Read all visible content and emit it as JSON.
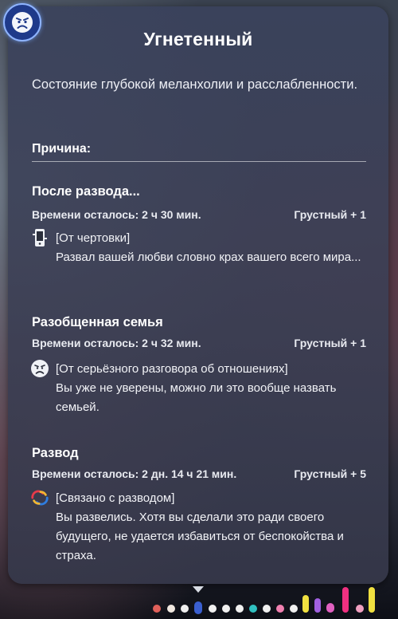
{
  "tooltip": {
    "title": "Угнетенный",
    "description": "Состояние глубокой меланхолии и расслабленности.",
    "reason_label": "Причина:",
    "mood_icon": "sad-face-icon"
  },
  "modifiers": [
    {
      "name": "После развода...",
      "time_left": "Времени осталось: 2 ч 30 мин.",
      "effect": "Грустный + 1",
      "source": "[От чертовки]",
      "text": "Развал вашей любви словно крах вашего всего мира...",
      "icon": "phone-icon"
    },
    {
      "name": "Разобщенная семья",
      "time_left": "Времени осталось: 2 ч 32 мин.",
      "effect": "Грустный + 1",
      "source": "[От серьёзного разговора об отношениях]",
      "text": "Вы уже не уверены, можно ли это вообще назвать семьей.",
      "icon": "sad-face-icon"
    },
    {
      "name": "Развод",
      "time_left": "Времени осталось: 2 дн. 14 ч 21 мин.",
      "effect": "Грустный + 5",
      "source": "[Связано с разводом]",
      "text": "Вы развелись. Хотя вы сделали это ради своего будущего, не удается избавиться от беспокойства и страха.",
      "icon": "broken-rings-icon"
    }
  ],
  "colors": {
    "badge": "#1f3a8a",
    "badge_border": "#8fb4ff",
    "panel": "#3c4256"
  }
}
